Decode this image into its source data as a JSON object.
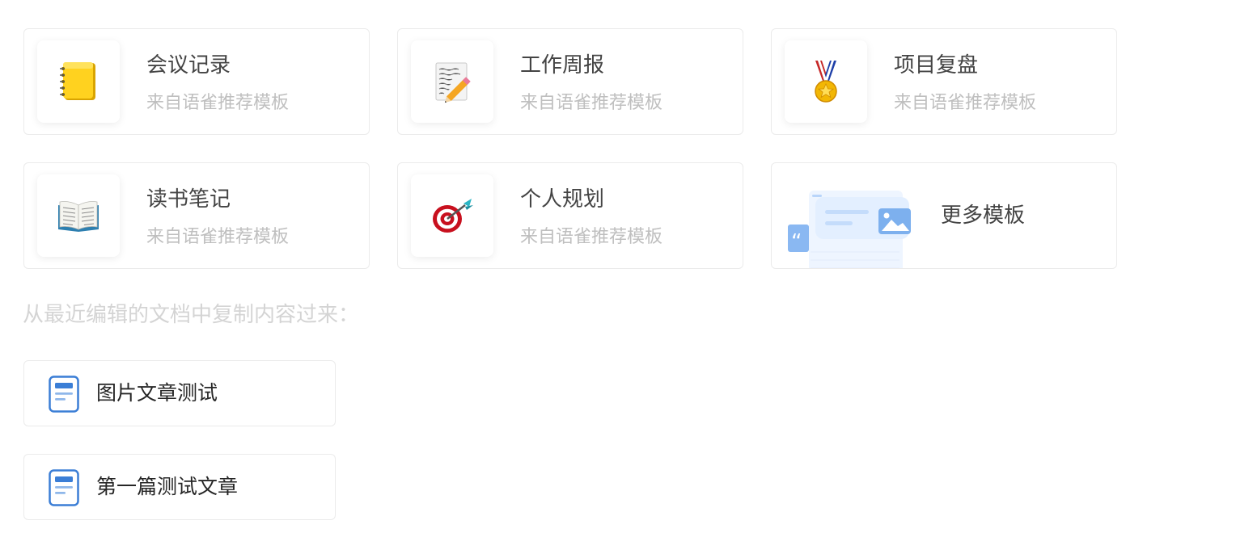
{
  "templates": [
    {
      "title": "会议记录",
      "subtitle": "来自语雀推荐模板",
      "icon": "notebook-icon"
    },
    {
      "title": "工作周报",
      "subtitle": "来自语雀推荐模板",
      "icon": "memo-pencil-icon"
    },
    {
      "title": "项目复盘",
      "subtitle": "来自语雀推荐模板",
      "icon": "medal-icon"
    },
    {
      "title": "读书笔记",
      "subtitle": "来自语雀推荐模板",
      "icon": "open-book-icon"
    },
    {
      "title": "个人规划",
      "subtitle": "来自语雀推荐模板",
      "icon": "target-dart-icon"
    }
  ],
  "more_templates": {
    "label": "更多模板",
    "icon": "template-illustration-icon"
  },
  "recent": {
    "label": "从最近编辑的文档中复制内容过来：",
    "docs": [
      {
        "title": "图片文章测试",
        "icon": "document-icon"
      },
      {
        "title": "第一篇测试文章",
        "icon": "document-icon"
      }
    ]
  },
  "colors": {
    "accent": "#3b7ed6",
    "title_text": "#444444",
    "subtitle_text": "#bfbfbf",
    "card_border": "#ebebeb"
  }
}
